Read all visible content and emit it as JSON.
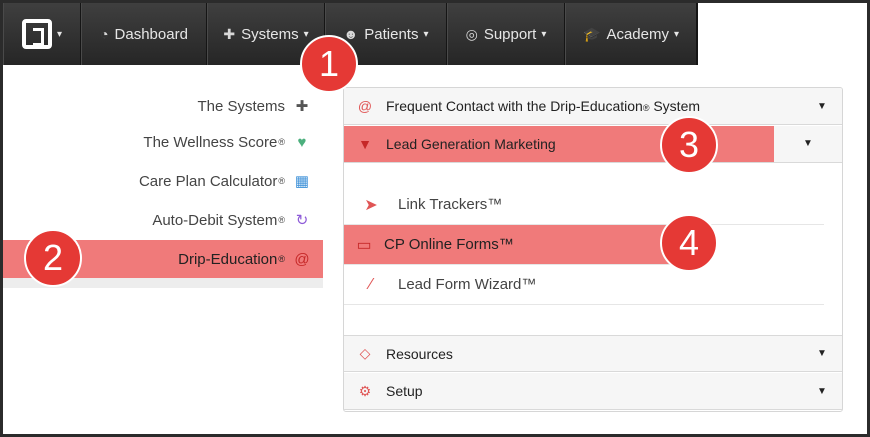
{
  "navbar": {
    "logo_icon": "brand-logo",
    "items": [
      {
        "label": "Dashboard",
        "icon": "dashboard-icon",
        "icon_glyph": "◔"
      },
      {
        "label": "Systems",
        "icon": "puzzle-icon",
        "icon_glyph": "✚"
      },
      {
        "label": "Patients",
        "icon": "users-icon",
        "icon_glyph": "☻"
      },
      {
        "label": "Support",
        "icon": "lifebuoy-icon",
        "icon_glyph": "◎"
      },
      {
        "label": "Academy",
        "icon": "graduation-cap-icon",
        "icon_glyph": "🎓"
      }
    ],
    "caret": "▾"
  },
  "sidebar": {
    "items": [
      {
        "label": "The Systems",
        "reg": "",
        "icon": "puzzle-icon",
        "icon_glyph": "✚",
        "icon_color": "#555555"
      },
      {
        "label": "The Wellness Score",
        "reg": "®",
        "icon": "heartbeat-icon",
        "icon_glyph": "♥",
        "icon_color": "#4caf7d"
      },
      {
        "label": "Care Plan Calculator",
        "reg": "®",
        "icon": "calculator-icon",
        "icon_glyph": "▦",
        "icon_color": "#3a8fd8"
      },
      {
        "label": "Auto-Debit System",
        "reg": "®",
        "icon": "refresh-icon",
        "icon_glyph": "↻",
        "icon_color": "#8e5bd8"
      },
      {
        "label": "Drip-Education",
        "reg": "®",
        "icon": "at-icon",
        "icon_glyph": "@",
        "icon_color": "#c62828"
      }
    ]
  },
  "panel": {
    "sections": [
      {
        "label": "Frequent Contact with the Drip-Education",
        "reg": "®",
        "suffix": " System",
        "icon": "at-icon",
        "icon_glyph": "@"
      },
      {
        "label": "Lead Generation Marketing",
        "icon": "filter-icon",
        "icon_glyph": "▼"
      },
      {
        "label": "Resources",
        "icon": "diamond-icon",
        "icon_glyph": "◇"
      },
      {
        "label": "Setup",
        "icon": "cogs-icon",
        "icon_glyph": "⚙"
      }
    ],
    "sub_items": [
      {
        "label": "Link Trackers™",
        "icon": "cursor-icon",
        "icon_glyph": "➤"
      },
      {
        "label": "CP Online Forms™",
        "icon": "desktop-icon",
        "icon_glyph": "▭"
      },
      {
        "label": "Lead Form Wizard™",
        "icon": "magic-wand-icon",
        "icon_glyph": "⁄"
      }
    ],
    "caret": "▼"
  },
  "badges": [
    "1",
    "2",
    "3",
    "4"
  ],
  "colors": {
    "highlight": "#f07a7a",
    "badge": "#e53935",
    "navbar": "#2e2e2e",
    "accent_icon": "#e05555"
  }
}
